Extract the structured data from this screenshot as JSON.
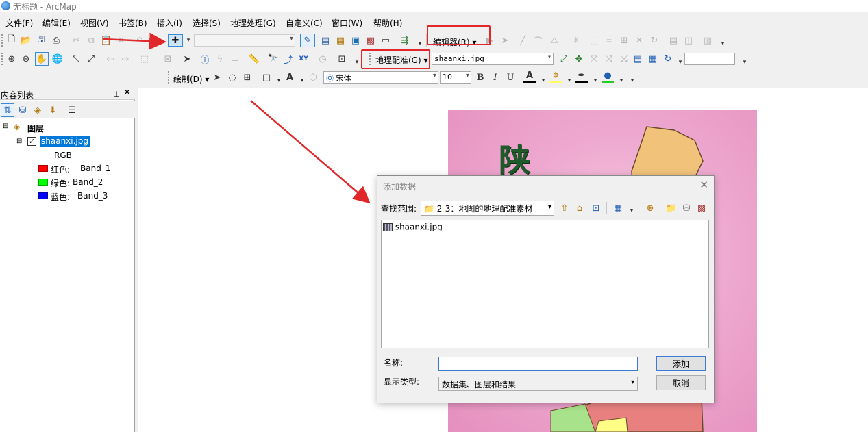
{
  "window": {
    "title": "无标题 - ArcMap"
  },
  "menubar": {
    "items": [
      {
        "label": "文件(F)"
      },
      {
        "label": "编辑(E)"
      },
      {
        "label": "视图(V)"
      },
      {
        "label": "书签(B)"
      },
      {
        "label": "插入(I)"
      },
      {
        "label": "选择(S)"
      },
      {
        "label": "地理处理(G)"
      },
      {
        "label": "自定义(C)"
      },
      {
        "label": "窗口(W)"
      },
      {
        "label": "帮助(H)"
      }
    ]
  },
  "toolbar_editor": {
    "label": "编辑器(R)"
  },
  "toolbar_georef": {
    "label": "地理配准(G)",
    "layer_value": "shaanxi.jpg"
  },
  "toolbar_draw": {
    "label": "绘制(D)",
    "font_value": "宋体",
    "size_value": "10",
    "bold": "B",
    "italic": "I",
    "underline": "U",
    "font_color": "A"
  },
  "toc": {
    "title": "内容列表",
    "layers_label": "图层",
    "layer_name": "shaanxi.jpg",
    "rgb_label": "RGB",
    "bands": [
      {
        "label": "红色:",
        "band": "Band_1",
        "color": "#ff0000"
      },
      {
        "label": "绿色:",
        "band": "Band_2",
        "color": "#00ff00"
      },
      {
        "label": "蓝色:",
        "band": "Band_3",
        "color": "#0000ff"
      }
    ]
  },
  "map": {
    "visible_char": "陕"
  },
  "dialog": {
    "title": "添加数据",
    "lookin_label": "查找范围:",
    "lookin_value": "2-3：地图的地理配准素材",
    "files": [
      {
        "name": "shaanxi.jpg"
      }
    ],
    "name_label": "名称:",
    "name_value": "",
    "type_label": "显示类型:",
    "type_value": "数据集、图层和结果",
    "add_button": "添加",
    "cancel_button": "取消"
  },
  "colors": {
    "highlight": "#0078d7",
    "annotation_red": "#e0282a"
  }
}
